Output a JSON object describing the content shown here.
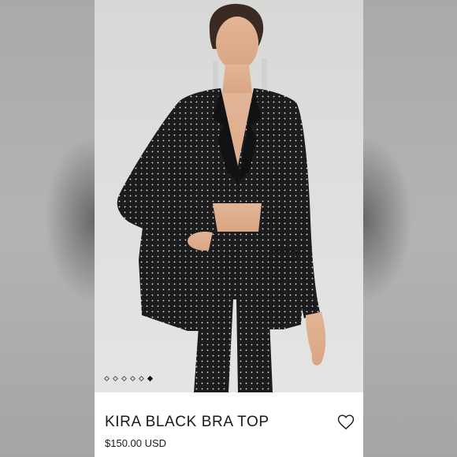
{
  "product": {
    "name": "KIRA BLACK BRA TOP",
    "price": "$150.00 USD"
  },
  "gallery": {
    "image_count": 6,
    "active_index": 5,
    "icon": "product-photo"
  },
  "wishlist": {
    "icon": "heart-outline-icon"
  },
  "colors": {
    "card_background": "#ffffff",
    "photo_background": "#dedede",
    "garment": "#1d1d1f",
    "text": "#1a1a1a",
    "side_blur": "#b0b0b0"
  }
}
